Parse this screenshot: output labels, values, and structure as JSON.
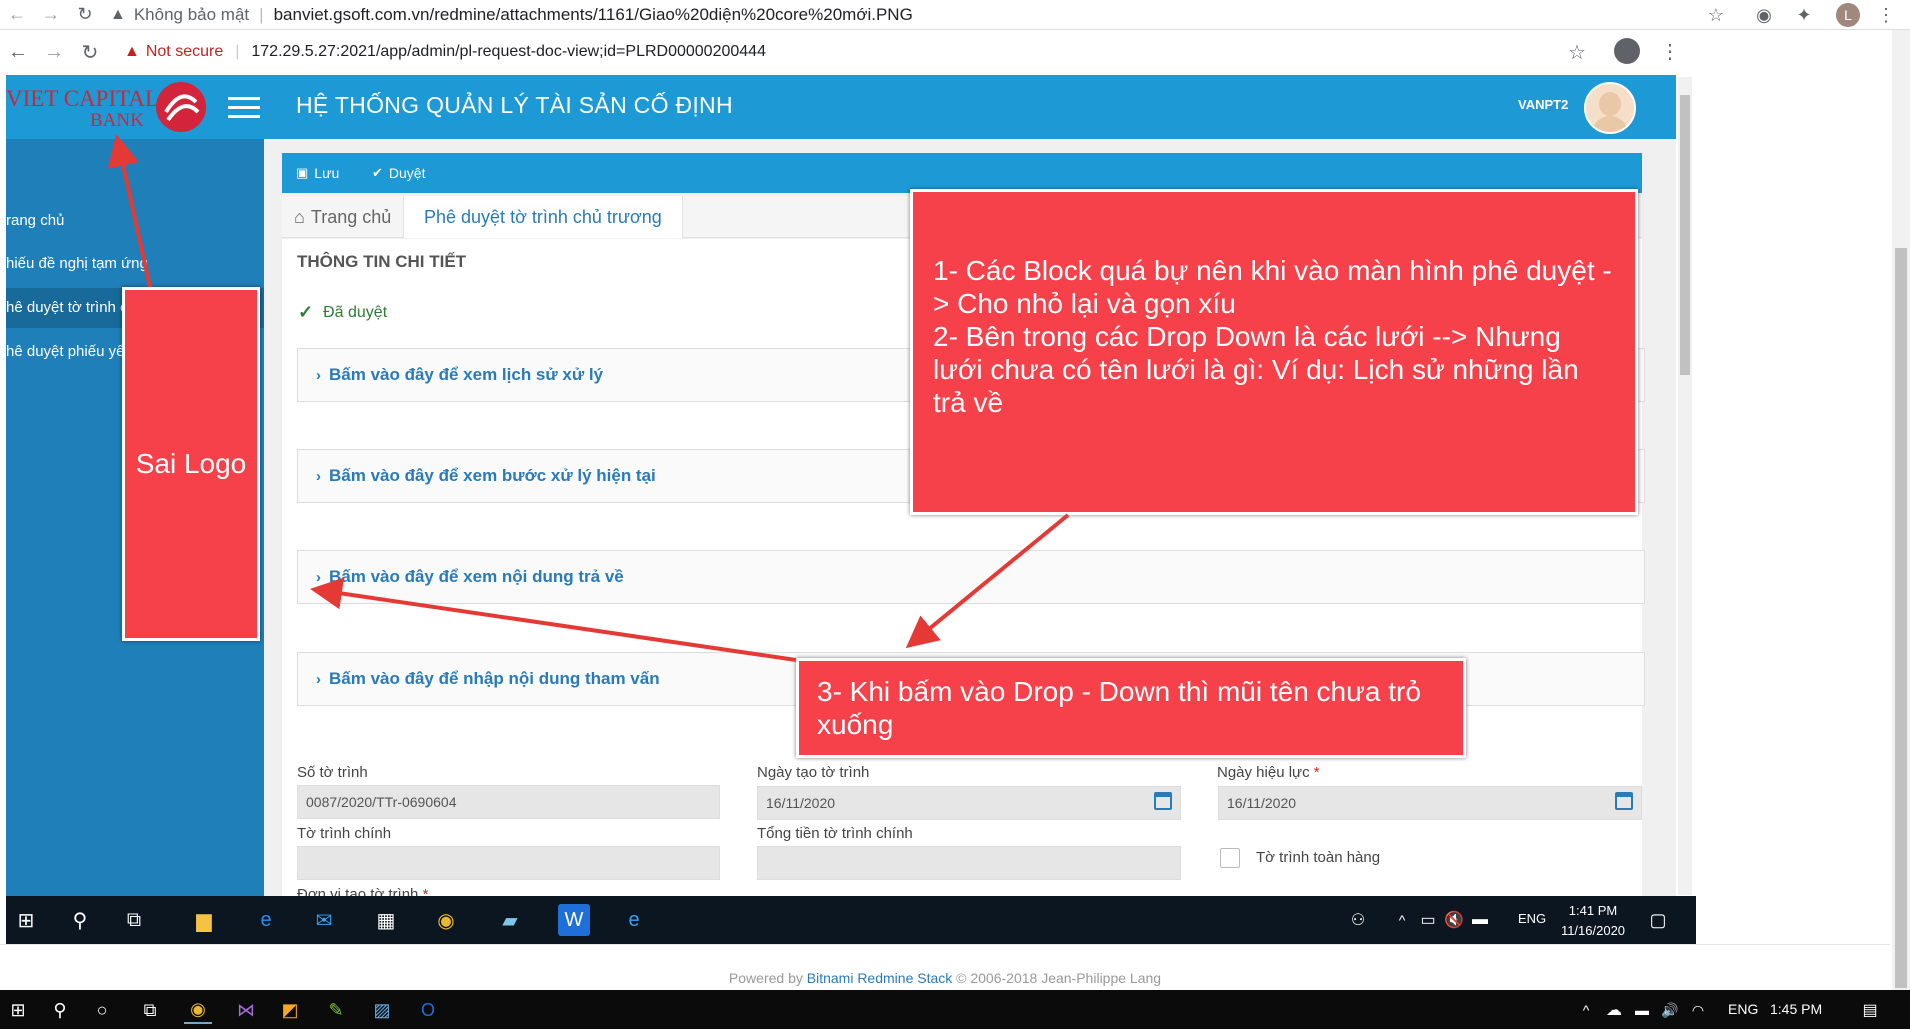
{
  "outer_browser": {
    "security_label": "Không bảo mật",
    "url": "banviet.gsoft.com.vn/redmine/attachments/1161/Giao%20diện%20core%20mới.PNG",
    "avatar_letter": "L"
  },
  "inner_browser": {
    "security_label": "Not secure",
    "url": "172.29.5.27:2021/app/admin/pl-request-doc-view;id=PLRD00000200444"
  },
  "logo": {
    "line1": "VIET CAPITAL",
    "line2": "BANK"
  },
  "header": {
    "title": "HỆ THỐNG QUẢN LÝ TÀI SẢN CỐ ĐỊNH",
    "username": "VANPT2"
  },
  "sidebar": {
    "items": [
      {
        "label": "rang chủ"
      },
      {
        "label": "hiếu đề nghị tạm ứng"
      },
      {
        "label": "hê duyệt tờ trình c"
      },
      {
        "label": "hê duyệt phiếu yê"
      }
    ]
  },
  "toolbar": {
    "save_label": "Lưu",
    "approve_label": "Duyệt"
  },
  "breadcrumb": {
    "home": "Trang chủ",
    "current": "Phê duyệt tờ trình chủ trương"
  },
  "detail": {
    "title": "THÔNG TIN CHI TIẾT",
    "status": "Đã duyệt",
    "accordions": [
      {
        "label": "Bấm vào đây để xem lịch sử xử lý"
      },
      {
        "label": "Bấm vào đây để xem bước xử lý hiện tại"
      },
      {
        "label": "Bấm vào đây để xem nội dung trả về"
      },
      {
        "label": "Bấm vào đây để nhập nội dung tham vấn"
      }
    ]
  },
  "form": {
    "so_to_trinh": {
      "label": "Số tờ trình",
      "value": "0087/2020/TTr-0690604"
    },
    "ngay_tao": {
      "label": "Ngày tạo tờ trình",
      "value": "16/11/2020"
    },
    "ngay_hieu_luc": {
      "label": "Ngày hiệu lực",
      "required": "*",
      "value": "16/11/2020"
    },
    "to_trinh_chinh": {
      "label": "Tờ trình chính",
      "value": ""
    },
    "tong_tien": {
      "label": "Tổng tiền tờ trình chính",
      "value": ""
    },
    "toan_hang": {
      "label": "Tờ trình toàn hàng",
      "checked": false
    },
    "don_vi": {
      "label": "Đơn vị tạo tờ trình",
      "required": "*"
    }
  },
  "taskbar_inner": {
    "time": "1:41 PM",
    "date": "11/16/2020",
    "lang": "ENG"
  },
  "footer": {
    "prefix": "Powered by",
    "link": "Bitnami Redmine Stack",
    "suffix": "© 2006-2018 Jean-Philippe Lang"
  },
  "taskbar_outer": {
    "time": "1:45 PM",
    "lang": "ENG"
  },
  "annotations": {
    "note1_lines": [
      "1- Các  Block quá bự nên khi vào màn hình phê duyệt -> Cho nhỏ lại và gọn xíu",
      "2- Bên trong các Drop Down là các lưới --> Nhưng lưới chưa có tên lưới là gì: Ví dụ: Lịch sử những lần trả về"
    ],
    "note2": "Sai Logo",
    "note3": "3- Khi bấm vào Drop - Down thì mũi tên chưa trỏ xuống"
  },
  "colors": {
    "header_blue": "#1d9ad6",
    "sidebar_blue": "#1f7fb8",
    "annotation_red": "#f7414a",
    "link_blue": "#2a7ab7"
  }
}
